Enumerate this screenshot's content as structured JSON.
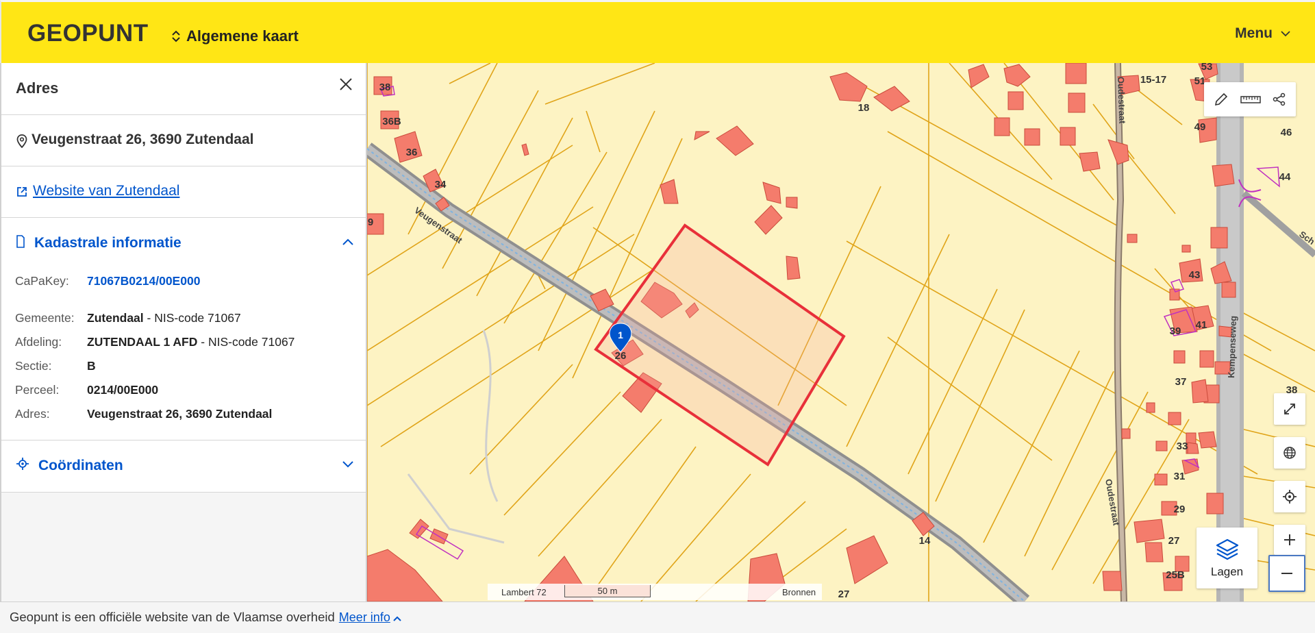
{
  "header": {
    "logo": "GEOPUNT",
    "map_switch": "Algemene kaart",
    "menu": "Menu"
  },
  "sidebar": {
    "title": "Adres",
    "address": "Veugenstraat 26, 3690 Zutendaal",
    "website_link": "Website van Zutendaal",
    "cadastral": {
      "heading": "Kadastrale informatie",
      "capakey_label": "CaPaKey:",
      "capakey_value": "71067B0214/00E000",
      "rows": [
        {
          "label": "Gemeente:",
          "value_bold": "Zutendaal",
          "value_rest": " - NIS-code 71067"
        },
        {
          "label": "Afdeling:",
          "value_bold": "ZUTENDAAL 1 AFD",
          "value_rest": " - NIS-code 71067"
        },
        {
          "label": "Sectie:",
          "value_bold": "B",
          "value_rest": ""
        },
        {
          "label": "Perceel:",
          "value_bold": "0214/00E000",
          "value_rest": ""
        },
        {
          "label": "Adres:",
          "value_bold": "Veugenstraat 26, 3690 Zutendaal",
          "value_rest": ""
        }
      ]
    },
    "coordinates_heading": "Coördinaten"
  },
  "map": {
    "street_labels": [
      "Veugenstraat",
      "Oudestraat",
      "Oudestraat",
      "Kempenseweg",
      "Sch"
    ],
    "house_numbers": [
      "38",
      "36B",
      "36",
      "34",
      "9",
      "18",
      "15-17",
      "53",
      "51",
      "49",
      "46",
      "44",
      "43",
      "41",
      "39",
      "37",
      "38",
      "33",
      "31",
      "29",
      "27",
      "25B",
      "14",
      "27",
      "26"
    ],
    "marker_label": "1",
    "layers_button": "Lagen",
    "scalebar": {
      "projection": "Lambert 72",
      "scale": "50 m",
      "sources": "Bronnen"
    },
    "colors": {
      "parcel_fill": "#fdf3c3",
      "parcel_line": "#e0a419",
      "building": "#f47c6c",
      "selection": "#e8303a",
      "marker": "#0055cc",
      "accent": "#ffe615"
    }
  },
  "footer": {
    "text": "Geopunt is een officiële website van de Vlaamse overheid",
    "more_info": "Meer info"
  }
}
